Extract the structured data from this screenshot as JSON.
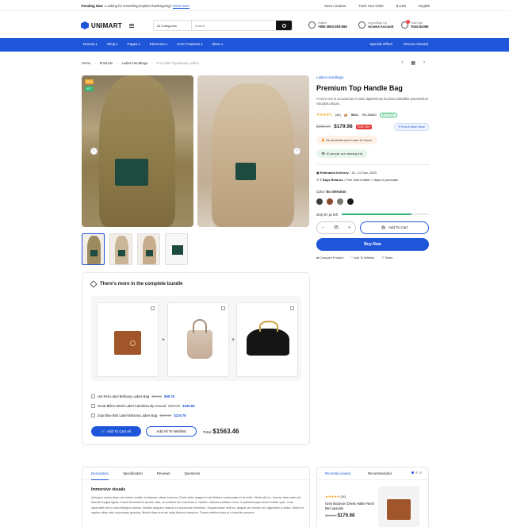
{
  "topbar": {
    "trending_label": "Trending Now :",
    "trending_text": "Looking for something Explore thanksgiving?",
    "trending_link": "Know more",
    "store_location": "Store Location",
    "track_order": "Track Your Order",
    "currency": "$ USD",
    "language": "English"
  },
  "header": {
    "logo": "UNIMART",
    "search_category": "All Categories",
    "search_placeholder": "Search",
    "hotline_label": "Hotline",
    "hotline_value": "+800 3053-353-569",
    "account_label": "Log In/Sign Up",
    "account_value": "Access Account",
    "cart_label": "Total Cart",
    "cart_value": "Total $2390",
    "cart_count": "0"
  },
  "nav": {
    "items": [
      "Demos",
      "Shop",
      "Pages",
      "Elements",
      "Core Features",
      "More"
    ],
    "special_offers": "Special Offers",
    "recent_viewed": "Recent Viewed"
  },
  "breadcrumb": {
    "items": [
      "Home",
      "Products",
      "Ladies Handbags"
    ],
    "current": "Pot Label Top Beauty Ladies"
  },
  "gallery": {
    "tag_new": "NEW",
    "tag_hot": "HOT"
  },
  "product": {
    "category": "Ladies Handbags",
    "title": "Premium Top Handle Bag",
    "description": "At vero eos et accusamus et iusto dignissimos ducimus blanditiis praesentium voluptatu atquis.",
    "stars": "★★★★½",
    "reviews": "(4b)",
    "sku_label": "SKU:",
    "sku": "HN-50880",
    "stock": "IN STOCK",
    "old_price": "$295.00",
    "new_price": "$179.98",
    "save_badge": "SAVE 35%",
    "find_store": "Find A Near Store",
    "sold_text": "34 products sold in last 10 hours.",
    "viewing_text": "20 people are viewing this",
    "delivery_label": "Estimated Delivery :",
    "delivery_value": "15 - 22 Nov, 2023",
    "returns_label": "7 Days Returns :",
    "returns_value": "Free return within 7 days of purchase",
    "color_label": "Color:",
    "color_value": "No Selection",
    "colors": [
      "#3a3f3b",
      "#8a4b2a",
      "#7b7b6e",
      "#1b1b1b"
    ],
    "left_label": "Only 97 pc left",
    "left_fraction": 0.8,
    "qty": "05",
    "qty_minus": "−",
    "qty_plus": "+",
    "add_to_cart": "Add To Cart",
    "buy_now": "Buy Now",
    "compare": "Compare Product",
    "wishlist": "Add To Wishlist",
    "share": "Share"
  },
  "bundle": {
    "title": "There's more in the complete bundle",
    "items": [
      {
        "name": "Uni Red Label Bethany Ladies Bag",
        "old": "$96.24",
        "new": "$69.78"
      },
      {
        "name": "Great Billion Mesh Label Calrdonia Zip Around",
        "old": "$606.34",
        "new": "$449.69"
      },
      {
        "name": "Zojo Blue Bird Label Britania Ladies Bag",
        "old": "$335.64",
        "new": "$219.78"
      }
    ],
    "add_all_cart": "Add To Cart All",
    "add_all_wishlist": "Add All To Wishlist",
    "total_label": "Total:",
    "total_value": "$1563.46"
  },
  "tabs": {
    "items": [
      "Description",
      "Specification",
      "Reviews",
      "Questions"
    ],
    "heading": "Immersive visuals",
    "text": "Quisque varius diam vel metus mattis, id aliquam diam rhoncus. Proin vitae magna in dui finibus malesuada et at nulla. Morbi elit ex, viverra vitae ante vel, blandit feugiat ligula. Fusce fermentum iaculis nibh, at sodales leo maximus a. Nullam ultricies sodales nunc, in pellentesque lorem mattis quis. Cras imperdiet est in nunc tristique lacinia. Nullam aliquam mauris eu accumsan tincidunt. Suspendisse velit ex, aliquet vel ornare vel, dignissim a tortor. Morbi ut sapien vitae odio accumsan gravida. Morbi vitae erat vel nulla finibus interdum. Donec eleifend purus a lobortis posuere."
  },
  "recent": {
    "tabs": [
      "Recently viewed",
      "Recommended"
    ],
    "product_stars": "★★★★★",
    "product_reviews": "(34)",
    "product_name": "Grey Bodycon Dress Halter Neck Mini upscale",
    "product_old": "$295.00",
    "product_new": "$179.98"
  }
}
